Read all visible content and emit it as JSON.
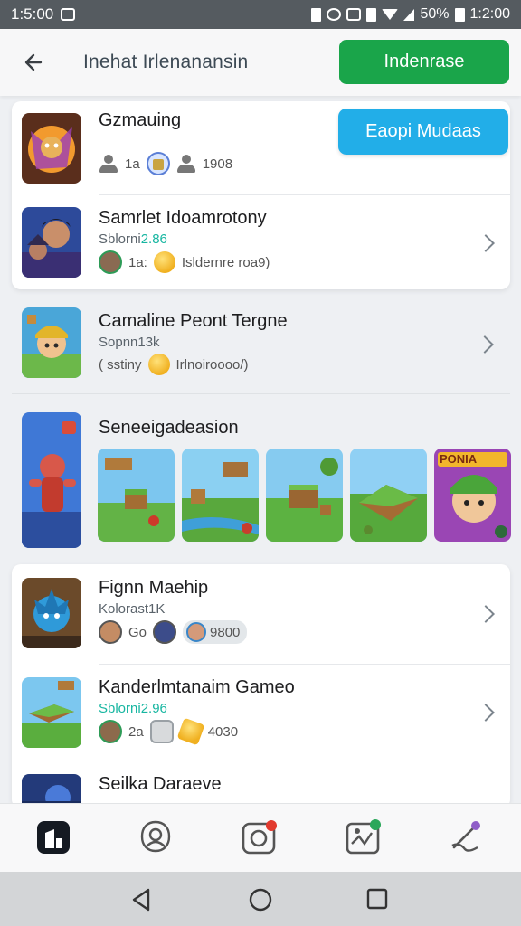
{
  "status": {
    "time_left": "1:5:00",
    "battery": "50%",
    "time_right": "1:2:00"
  },
  "header": {
    "title": "Inehat Irlenanansin",
    "action_label": "Indenrase"
  },
  "featured_button": "Eaopi Mudaas",
  "games": [
    {
      "name": "Gzmauing",
      "stat1": "1a",
      "stat2": "1908"
    },
    {
      "name": "Samrlet Idoamrotony",
      "sub_prefix": "Sblorni",
      "sub_hl": "2.86",
      "stat1": "1a:",
      "stat2": "Isldernre roa9)"
    },
    {
      "name": "Camaline Peont Tergne",
      "sub": "Sopnn13k",
      "stat1": "( sstiny",
      "stat2": "Irlnoiroooo/)"
    },
    {
      "name": "Seneeigadeasion"
    },
    {
      "name": "Fignn Maehip",
      "sub": "Kolorast1K",
      "stat1": "Go",
      "stat2": "9800"
    },
    {
      "name": "Kanderlmtanaim Gameo",
      "sub_prefix": "Sblorni",
      "sub_hl": "2.96",
      "stat1": "2a",
      "stat2": "4030"
    },
    {
      "name": "Seilka Daraeve"
    }
  ],
  "shot_badge": "PONIA",
  "nav": [
    "home-icon",
    "profile-icon",
    "messages-icon",
    "activity-icon",
    "settings-icon"
  ],
  "colors": {
    "green": "#1aa54a",
    "blue": "#22aee8",
    "teal": "#17b6a1"
  }
}
